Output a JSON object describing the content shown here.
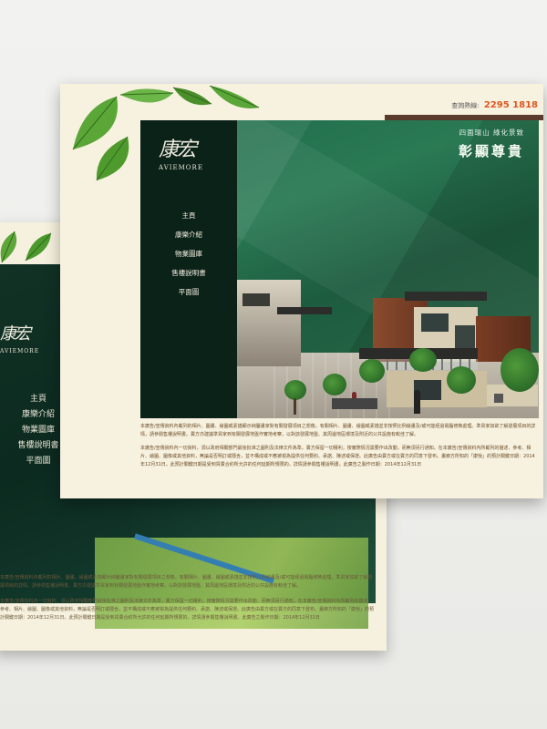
{
  "hotline": {
    "label": "查詢熱線:",
    "number": "2295 1818"
  },
  "hero": {
    "subtitle": "四面環山 綠化景致",
    "title": "彰顯尊貴"
  },
  "logo": {
    "chinese": "康宏",
    "english": "AVIEMORE"
  },
  "nav": {
    "items": [
      "主頁",
      "康樂介紹",
      "物業圖庫",
      "售樓說明書",
      "平面圖"
    ]
  },
  "disclaimer": {
    "p1": "本廣告/宣傳資料內載列的相片、圖畫、繪圖或素描顯示純屬畫家對有關發展項目之想像。有關相片、圖畫、繪圖或素描並非按照比例繪畫及/或可能經過電腦修飾處理。準買家如欲了解發展項目的詳情，請參閱售樓說明書。賣方亦建議準買家到有關發展地盤作實地考察，以對該發展地盤、其周邊地區環境及附近的公共設施有較佳了解。",
    "p2": "本廣告/宣傳資料內一切資料，須以政府相關部門最後批准之圖則及法律文件為準。賣方保留一切權利，按實際情況需要作出改動，而無須另行通知。在本廣告/宣傳資料內所載列的描述、參考、相片、繪圖、圖像或其他資料，無論是否明訂或隱含，並不構成或不應被視為提供任何要約、承諾、陳述或保證。此廣告由賣方或在賣方的同意下發布。畫廊方所知的「康悅」的預計關鍵日期：2014年12月31日。此預計關鍵日期是受到買賣合約所允許的任何延期所規限的。詳情請參閱售樓說明書。此廣告之製作日期：2014年12月31日"
  },
  "back": {
    "nav": [
      "主頁",
      "康樂介紹",
      "物業圖庫",
      "售樓說明書",
      "平面圖"
    ],
    "logo_chinese": "康宏",
    "logo_english": "AVIEMORE",
    "p1": "本廣告/宣傳資料內載列的相片、圖畫、繪圖或素描顯示純屬畫家對有關發展項目之想像。有關相片、圖畫、繪圖或素描並非按照比例繪畫及/或可能經過電腦修飾處理。準買家如欲了解發展項目的詳情，請參閱售樓說明書。賣方亦建議準買家到有關發展地盤作實地考察，以對該發展地盤、其周邊地區環境及附近的公共設施有較佳了解。",
    "p2": "本廣告/宣傳資料內一切資料，須以政府相關部門最後批准之圖則及法律文件為準。賣方保留一切權利，按實際情況需要作出改動，而無須另行通知。在本廣告/宣傳資料內所載列的描述、參考、相片、繪圖、圖像或其他資料，無論是否明訂或隱含，並不構成或不應被視為提供任何要約、承諾、陳述或保證。此廣告由賣方或在賣方的同意下發布。畫廊方所知的「康悅」的預計關鍵日期：2014年12月31日。此預計關鍵日期是受到買賣合約所允許的任何延期所規限的。詳情請參閱售樓說明書。此廣告之製作日期：2014年12月31日"
  },
  "colors": {
    "accent": "#e0561f",
    "sidebar": "#0b2219",
    "hero": "#1e6a49",
    "paper": "#f7f1e0"
  }
}
